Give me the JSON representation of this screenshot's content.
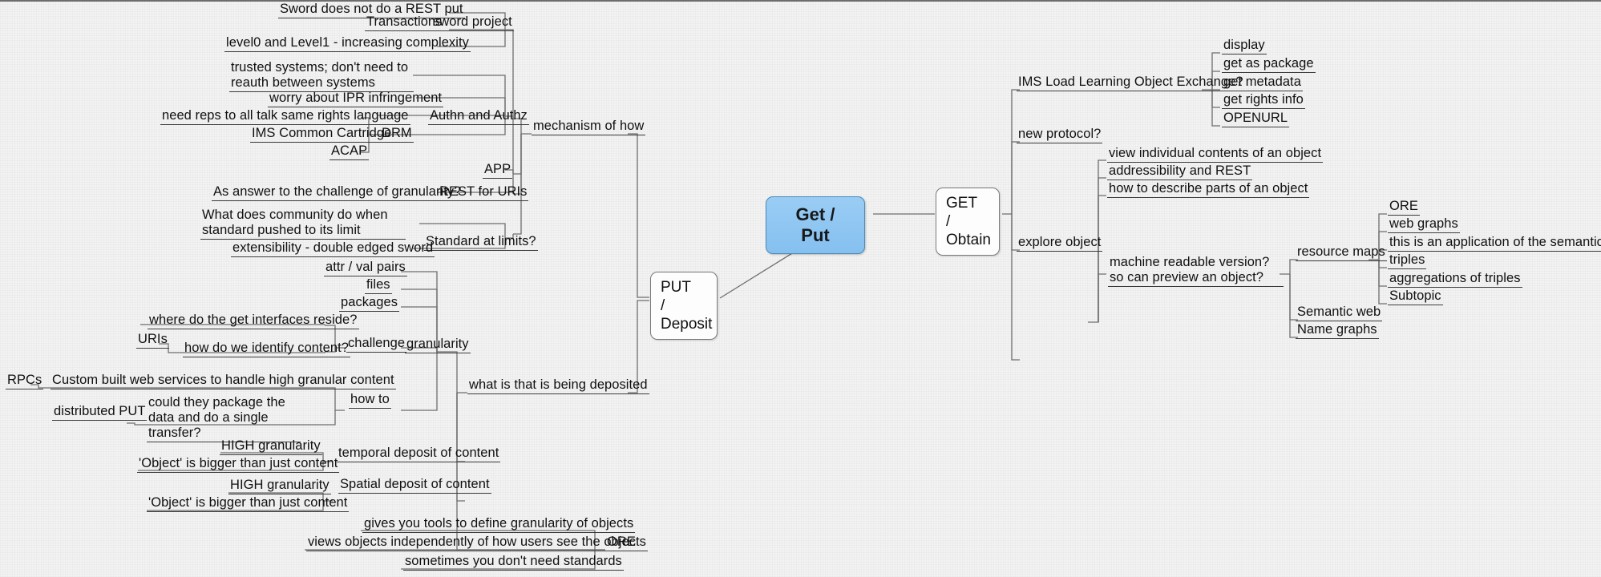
{
  "diagram": {
    "type": "mind-map",
    "title": "Get / Put",
    "root": {
      "label": "Get / Put",
      "color": "#8ec6f2"
    }
  },
  "nodes": {
    "root": "Get / Put",
    "get_obtain": "GET\n/\nObtain",
    "get_obtain_l1": "GET",
    "get_obtain_l2": "/",
    "get_obtain_l3": "Obtain",
    "put_deposit_l1": "PUT",
    "put_deposit_l2": "/",
    "put_deposit_l3": "Deposit",
    "mechanism_of_how": "mechanism of how",
    "what_deposited": "what is that is being deposited",
    "sword_project": "sword project",
    "sword_does_not": "Sword does not do a REST put",
    "transactions": "Transactions",
    "level0_level1": "level0 and Level1 - increasing complexity",
    "authn_authz": "Authn and Authz",
    "trusted_systems": "trusted systems; don't need to reauth between systems",
    "worry_ipr": "worry about IPR infringement",
    "need_reps": "need reps to all talk same rights language",
    "drm": "DRM",
    "ims_common_cartridge": "IMS Common Cartridge",
    "acap": "ACAP",
    "app": "APP",
    "rest_for_uris": "REST for URIs",
    "as_answer": "As answer to the challenge of granularity?",
    "standard_at_limits": "Standard at limits?",
    "what_does_community": "What does community do when standard pushed to its limit",
    "extensibility": "extensibility - double edged sword",
    "granularity": "granularity",
    "attr_val_pairs": "attr / val pairs",
    "files": "files",
    "packages": "packages",
    "challenge": "challenge",
    "where_get_interfaces": "where do the get interfaces reside?",
    "uris": "URIs",
    "how_do_we_identify": "how do we identify content?",
    "how_to": "how to",
    "rpcs": "RPCs",
    "custom_built": "Custom built web services to handle high granular content",
    "distributed_put": "distributed PUT",
    "could_they_package": "could they package the data and do a single transfer?",
    "temporal_deposit": "temporal deposit of content",
    "temporal_high_granularity": "HIGH granularity",
    "temporal_object_bigger": "'Object' is bigger than just content",
    "spatial_deposit": "Spatial deposit of content",
    "spatial_high_granularity": "HIGH granularity",
    "spatial_object_bigger": "'Object' is bigger than just content",
    "ore_left": "ORE",
    "gives_you_tools": "gives you tools to define granularity of objects",
    "views_objects": "views objects independently of how users see the objects",
    "sometimes_standards": "sometimes you don't need standards",
    "ims_load": "IMS Load Learning Object Exchange?",
    "display": "display",
    "get_as_package": "get as package",
    "get_metadata": "get metadata",
    "get_rights_info": "get rights info",
    "openurl": "OPENURL",
    "new_protocol": "new protocol?",
    "view_individual": "view individual contents of an object",
    "addressibility_rest": "addressibility and REST",
    "how_describe_parts": "how to describe parts of an object",
    "explore_object": "explore object",
    "machine_readable": "machine readable version? so can preview an object?",
    "resource_maps": "resource maps",
    "semantic_web": "Semantic web",
    "name_graphs": "Name graphs",
    "ore_right": "ORE",
    "web_graphs": "web graphs",
    "this_is_application": "this is an application of the semantic web",
    "triples": "triples",
    "aggregations_triples": "aggregations of triples",
    "subtopic": "Subtopic"
  }
}
